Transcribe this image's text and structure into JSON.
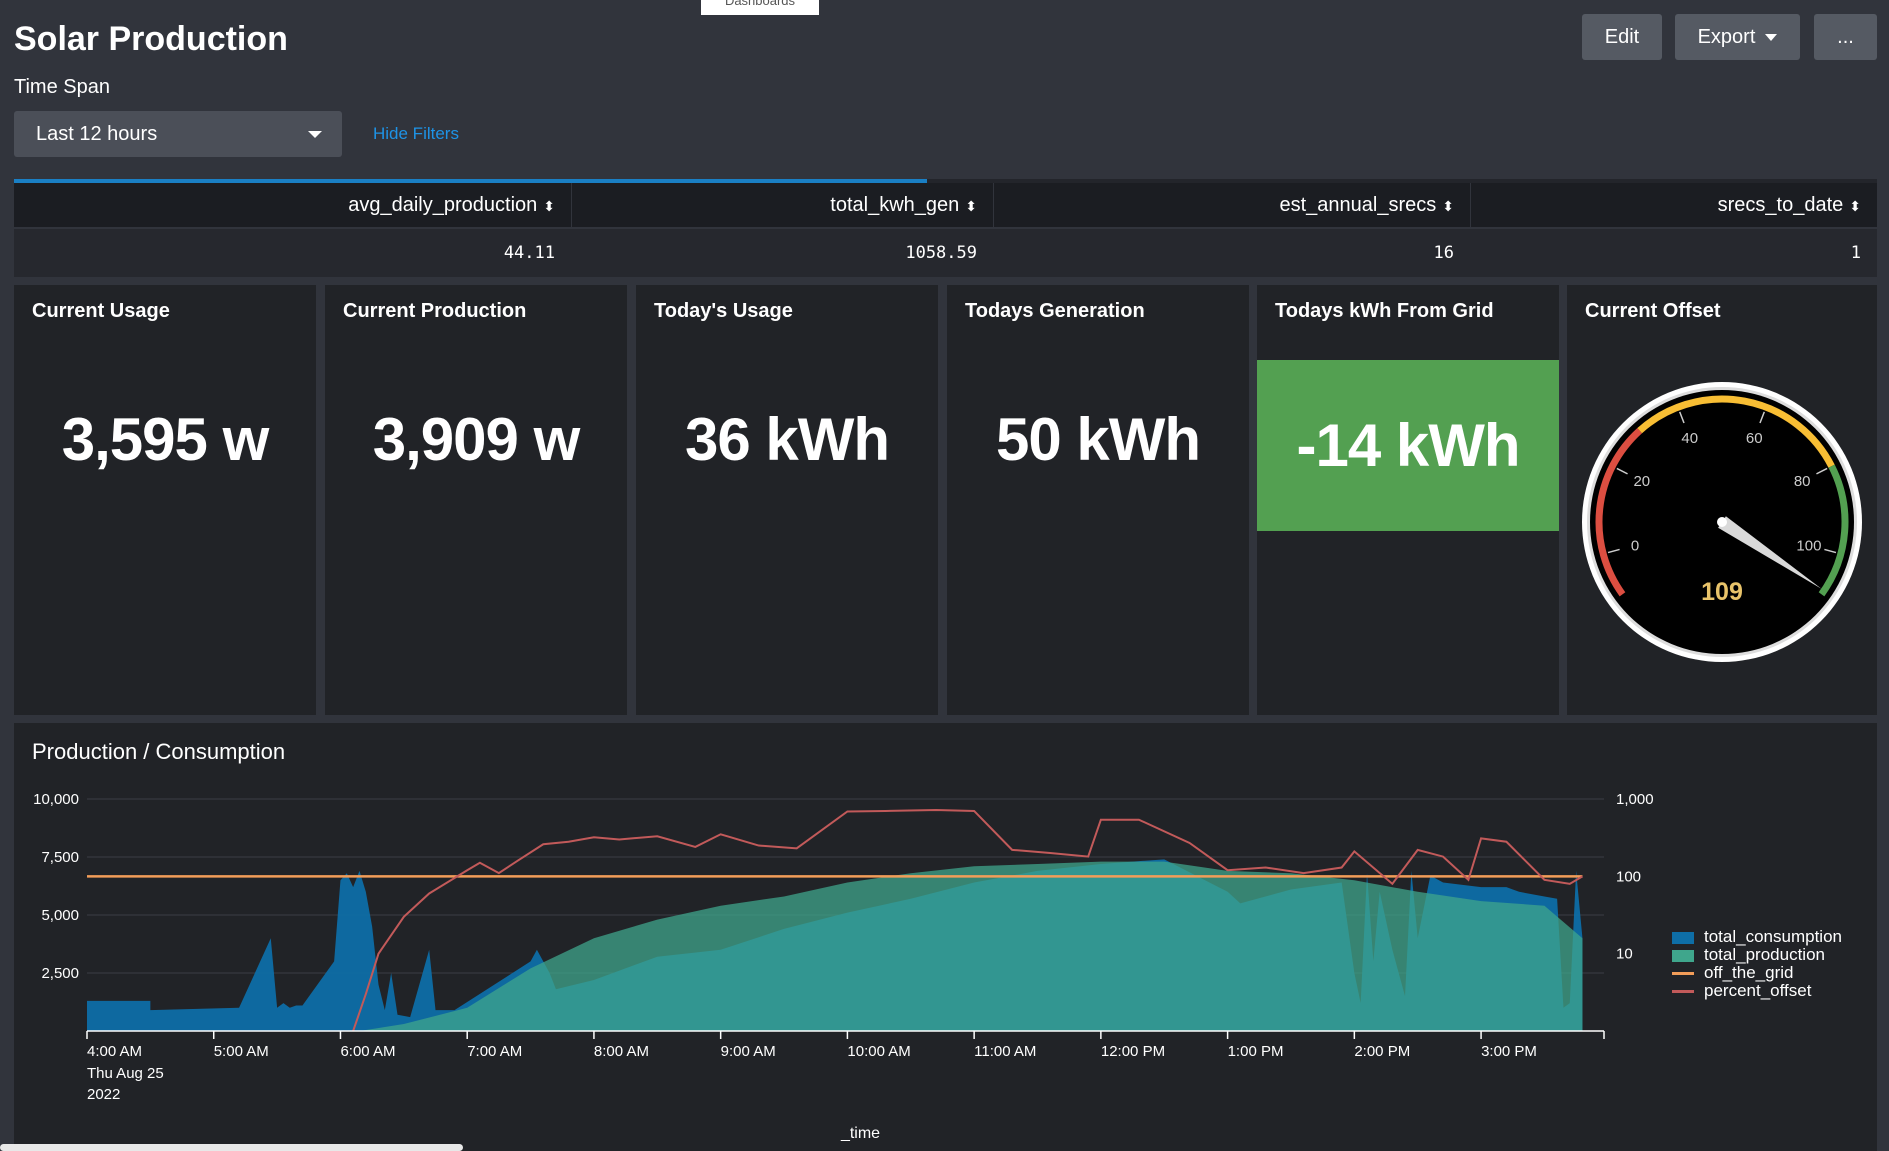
{
  "breadcrumb_tab": "Dashboards",
  "page_title": "Solar Production",
  "header_buttons": {
    "edit": "Edit",
    "export": "Export",
    "more": "..."
  },
  "filters": {
    "time_span_label": "Time Span",
    "time_span_value": "Last 12 hours",
    "hide_filters": "Hide Filters"
  },
  "search_progress": 0.49,
  "summary_table": {
    "columns": [
      "avg_daily_production",
      "total_kwh_gen",
      "est_annual_srecs",
      "srecs_to_date"
    ],
    "sort_icon": "sort-icon",
    "row": [
      "44.11",
      "1058.59",
      "16",
      "1"
    ]
  },
  "single_values": [
    {
      "title": "Current Usage",
      "value": "3,595 w"
    },
    {
      "title": "Current Production",
      "value": "3,909 w"
    },
    {
      "title": "Today's Usage",
      "value": "36 kWh"
    },
    {
      "title": "Todays Generation",
      "value": "50 kWh"
    },
    {
      "title": "Todays kWh From Grid",
      "value": "-14 kWh",
      "color": "#53a051"
    }
  ],
  "gauge": {
    "title": "Current Offset",
    "value": 109,
    "display_value": "109",
    "min": -10,
    "max": 110,
    "ticks": [
      "0",
      "20",
      "40",
      "60",
      "80",
      "100"
    ],
    "bands": [
      {
        "from": -10,
        "to": 30,
        "color": "#dc4e41"
      },
      {
        "from": 30,
        "to": 80,
        "color": "#f8be34"
      },
      {
        "from": 80,
        "to": 110,
        "color": "#53a051"
      }
    ]
  },
  "chart_data": {
    "type": "area",
    "title": "Production / Consumption",
    "xlabel": "_time",
    "x_ticks": [
      "4:00 AM",
      "5:00 AM",
      "6:00 AM",
      "7:00 AM",
      "8:00 AM",
      "9:00 AM",
      "10:00 AM",
      "11:00 AM",
      "12:00 PM",
      "1:00 PM",
      "2:00 PM",
      "3:00 PM"
    ],
    "x_date_lines": [
      "Thu Aug 25",
      "2022"
    ],
    "y_left_ticks": [
      "2,500",
      "5,000",
      "7,500",
      "10,000"
    ],
    "y_left_range": [
      0,
      10000
    ],
    "y_right_ticks": [
      "10",
      "100",
      "1,000"
    ],
    "y_right_scale": "log",
    "y_right_range": [
      1,
      1000
    ],
    "colors": {
      "total_consumption": "#0e6ea6",
      "total_production": "#3fa68c",
      "off_the_grid": "#f29d59",
      "percent_offset": "#c25a5a"
    },
    "series": [
      {
        "name": "total_consumption",
        "axis": "left",
        "x_hours": [
          4.0,
          4.5,
          4.5,
          5.2,
          5.45,
          5.5,
          5.55,
          5.6,
          5.65,
          5.7,
          5.95,
          6.0,
          6.05,
          6.1,
          6.15,
          6.2,
          6.25,
          6.3,
          6.35,
          6.4,
          6.45,
          6.55,
          6.7,
          6.75,
          6.8,
          6.9,
          7.5,
          7.55,
          7.65,
          7.7,
          8.0,
          8.5,
          9.0,
          9.5,
          10.0,
          10.5,
          11.0,
          11.5,
          12.0,
          12.5,
          13.0,
          13.1,
          13.5,
          13.9,
          14.0,
          14.05,
          14.1,
          14.15,
          14.2,
          14.3,
          14.4,
          14.45,
          14.5,
          14.6,
          14.7,
          15.0,
          15.2,
          15.3,
          15.5,
          15.6,
          15.65,
          15.7,
          15.75,
          15.8
        ],
        "values": [
          1300,
          1300,
          900,
          1000,
          4000,
          1000,
          1200,
          1000,
          1100,
          1100,
          3000,
          6500,
          6800,
          6200,
          6900,
          6000,
          4500,
          2000,
          900,
          2500,
          700,
          600,
          3500,
          900,
          900,
          900,
          3000,
          3500,
          2500,
          1800,
          2200,
          3200,
          3500,
          4400,
          5100,
          5700,
          6400,
          6900,
          7200,
          7400,
          6000,
          5500,
          6100,
          6400,
          2500,
          1200,
          6800,
          3000,
          6000,
          3500,
          1500,
          6900,
          4000,
          6700,
          6400,
          6200,
          6200,
          6000,
          5800,
          5700,
          1000,
          1200,
          6900,
          4000
        ]
      },
      {
        "name": "total_production",
        "axis": "left",
        "x_hours": [
          4.0,
          6.15,
          6.5,
          7.0,
          7.5,
          8.0,
          8.5,
          9.0,
          9.5,
          10.0,
          10.5,
          11.0,
          11.5,
          12.0,
          12.5,
          13.0,
          13.5,
          14.0,
          14.5,
          15.0,
          15.5,
          15.8
        ],
        "values": [
          0,
          0,
          300,
          1000,
          2700,
          4000,
          4800,
          5400,
          5800,
          6400,
          6800,
          7100,
          7200,
          7300,
          7300,
          6900,
          6800,
          6500,
          6000,
          5600,
          5400,
          4000
        ]
      },
      {
        "name": "off_the_grid",
        "axis": "right",
        "x_hours": [
          4.0,
          15.8
        ],
        "values": [
          100,
          100
        ]
      },
      {
        "name": "percent_offset",
        "axis": "right",
        "x_hours": [
          6.1,
          6.2,
          6.3,
          6.5,
          6.7,
          7.0,
          7.1,
          7.25,
          7.4,
          7.6,
          7.8,
          8.0,
          8.2,
          8.5,
          8.8,
          9.0,
          9.3,
          9.6,
          10.0,
          10.3,
          10.7,
          11.0,
          11.3,
          11.6,
          11.9,
          12.0,
          12.3,
          12.7,
          13.0,
          13.3,
          13.6,
          13.9,
          14.0,
          14.3,
          14.5,
          14.7,
          14.9,
          15.0,
          15.2,
          15.5,
          15.7,
          15.8
        ],
        "values": [
          1,
          3,
          10,
          30,
          60,
          120,
          150,
          110,
          160,
          260,
          280,
          320,
          300,
          330,
          240,
          350,
          250,
          230,
          690,
          700,
          720,
          700,
          220,
          200,
          180,
          540,
          540,
          270,
          120,
          130,
          110,
          130,
          210,
          80,
          220,
          180,
          90,
          310,
          280,
          90,
          80,
          100
        ]
      }
    ]
  }
}
